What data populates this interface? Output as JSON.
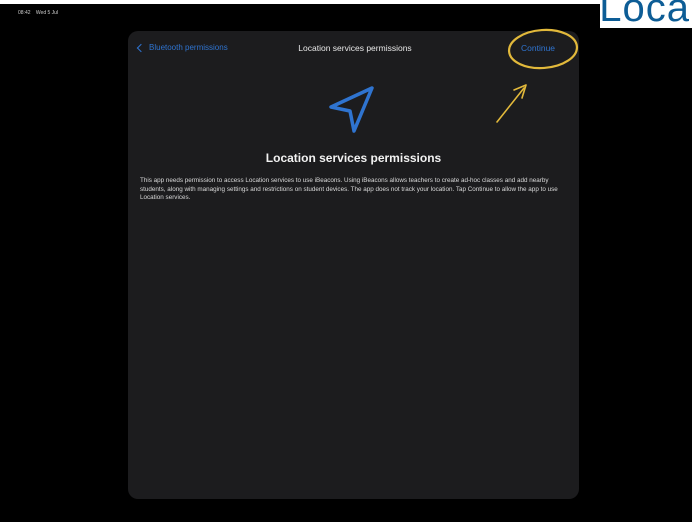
{
  "slide": {
    "title_fragment": "Loca"
  },
  "status_bar": {
    "time": "08:42",
    "date": "Wed 5 Jul"
  },
  "sheet": {
    "back_label": "Bluetooth permissions",
    "title": "Location services permissions",
    "continue_label": "Continue",
    "heading": "Location services permissions",
    "body": "This app needs permission to access Location services to use iBeacons. Using iBeacons allows teachers to create ad-hoc classes and add nearby students, along with managing settings and restrictions on student devices. The app does not track your location. Tap Continue to allow the app to use Location services."
  },
  "icons": {
    "location": "location-arrow-icon",
    "back": "chevron-left-icon"
  },
  "colors": {
    "accent": "#2f74d0",
    "annotation": "#e2b93b",
    "sheet_background": "#1c1c1e",
    "slide_title": "#0d5d96"
  }
}
